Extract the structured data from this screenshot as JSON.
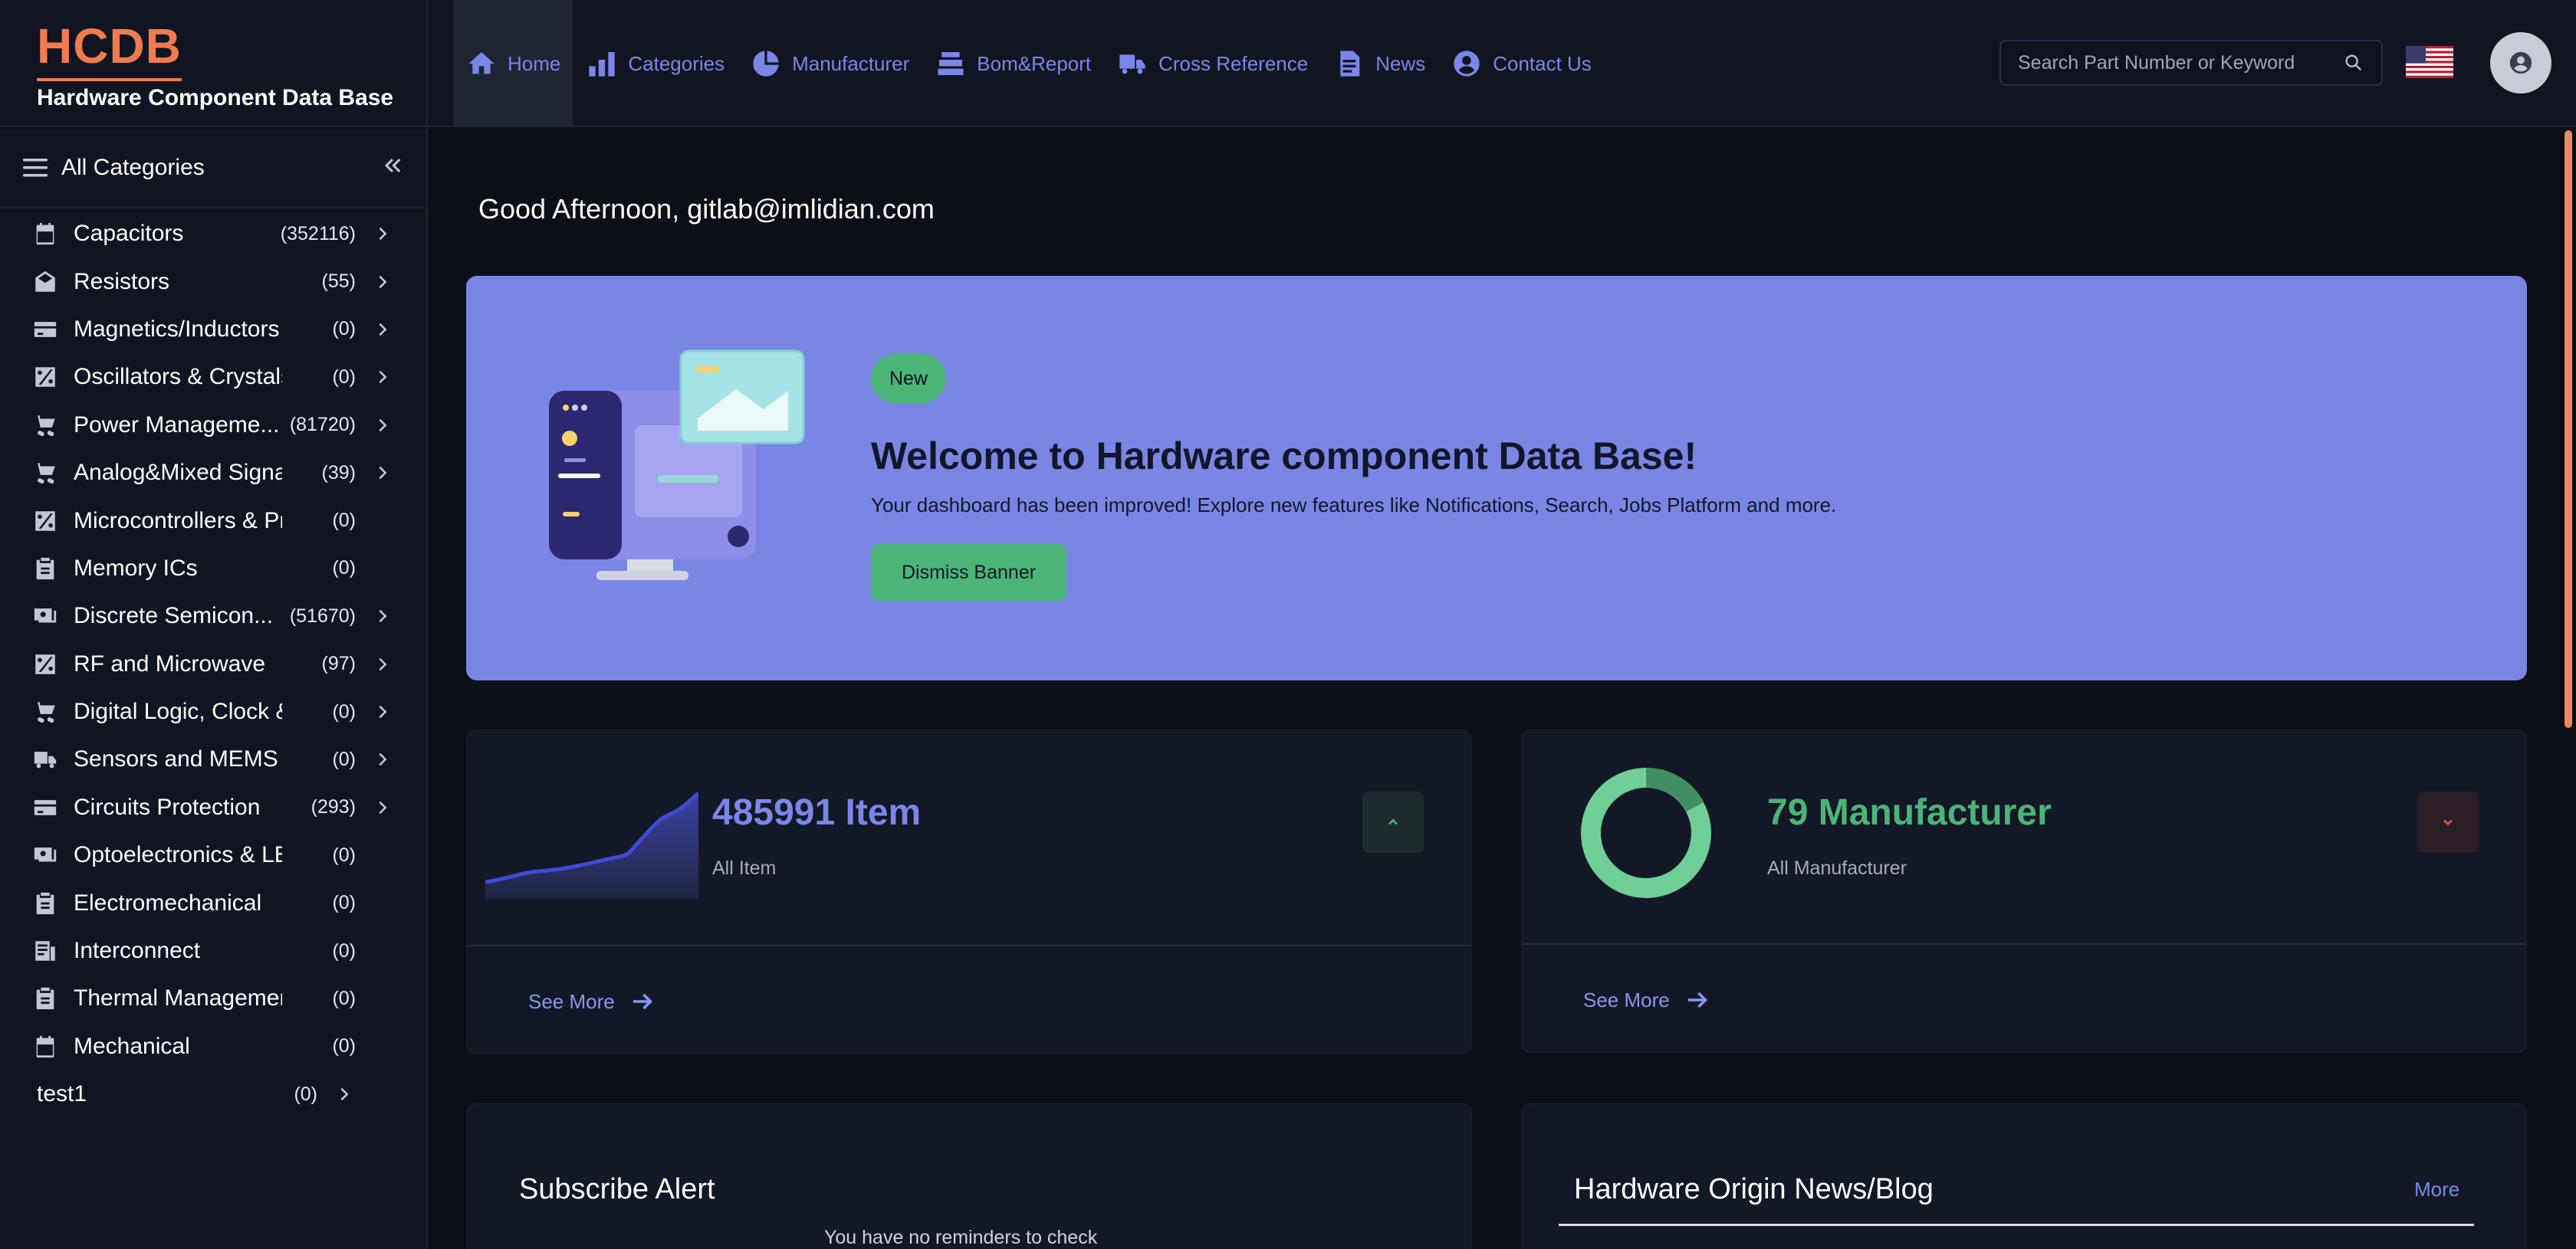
{
  "brand": {
    "logo": "HCDB",
    "subtitle": "Hardware Component Data Base"
  },
  "nav": {
    "items": [
      {
        "label": "Home",
        "icon": "home-icon",
        "active": true
      },
      {
        "label": "Categories",
        "icon": "bar-chart-icon"
      },
      {
        "label": "Manufacturer",
        "icon": "pie-chart-icon"
      },
      {
        "label": "Bom&Report",
        "icon": "stack-icon"
      },
      {
        "label": "Cross Reference",
        "icon": "truck-icon"
      },
      {
        "label": "News",
        "icon": "document-icon"
      },
      {
        "label": "Contact Us",
        "icon": "user-circle-icon"
      }
    ],
    "search_placeholder": "Search Part Number or Keyword",
    "language_flag": "us-flag-icon",
    "avatar_icon": "user-avatar-icon"
  },
  "sidebar": {
    "title": "All Categories",
    "items": [
      {
        "label": "Capacitors",
        "count": "(352116)",
        "icon": "calendar-icon",
        "chevron": true
      },
      {
        "label": "Resistors",
        "count": "(55)",
        "icon": "mail-open-icon",
        "chevron": true
      },
      {
        "label": "Magnetics/Inductors",
        "count": "(0)",
        "icon": "card-icon",
        "chevron": true
      },
      {
        "label": "Oscillators & Crystals",
        "count": "(0)",
        "icon": "percent-icon",
        "chevron": true
      },
      {
        "label": "Power Manageme...",
        "count": "(81720)",
        "icon": "cart-icon",
        "chevron": true
      },
      {
        "label": "Analog&Mixed Signa...",
        "count": "(39)",
        "icon": "cart-icon",
        "chevron": true
      },
      {
        "label": "Microcontrollers & Pr...",
        "count": "(0)",
        "icon": "percent-icon",
        "chevron": false
      },
      {
        "label": "Memory ICs",
        "count": "(0)",
        "icon": "clipboard-icon",
        "chevron": false
      },
      {
        "label": "Discrete Semicon...",
        "count": "(51670)",
        "icon": "cash-icon",
        "chevron": true
      },
      {
        "label": "RF and Microwave",
        "count": "(97)",
        "icon": "percent-icon",
        "chevron": true
      },
      {
        "label": "Digital Logic, Clock & ...",
        "count": "(0)",
        "icon": "cart-icon",
        "chevron": true
      },
      {
        "label": "Sensors and MEMS",
        "count": "(0)",
        "icon": "truck-icon",
        "chevron": true
      },
      {
        "label": "Circuits Protection",
        "count": "(293)",
        "icon": "card-icon",
        "chevron": true
      },
      {
        "label": "Optoelectronics & LEDs",
        "count": "(0)",
        "icon": "cash-icon",
        "chevron": false
      },
      {
        "label": "Electromechanical",
        "count": "(0)",
        "icon": "clipboard-icon",
        "chevron": false
      },
      {
        "label": "Interconnect",
        "count": "(0)",
        "icon": "receipt-icon",
        "chevron": false
      },
      {
        "label": "Thermal Management",
        "count": "(0)",
        "icon": "clipboard-icon",
        "chevron": false
      },
      {
        "label": "Mechanical",
        "count": "(0)",
        "icon": "calendar-icon",
        "chevron": false
      },
      {
        "label": "test1",
        "count": "(0)",
        "icon": "",
        "chevron": true
      }
    ]
  },
  "main": {
    "greeting": "Good Afternoon, gitlab@imlidian.com",
    "banner": {
      "badge": "New",
      "title": "Welcome to Hardware component Data Base!",
      "text": "Your dashboard has been improved! Explore new features like Notifications, Search, Jobs Platform and more.",
      "button": "Dismiss Banner"
    },
    "items_card": {
      "value": "485991 Item",
      "label": "All Item",
      "see_more": "See More",
      "color": "#7b86e8"
    },
    "manufacturer_card": {
      "value": "79 Manufacturer",
      "label": "All Manufacturer",
      "see_more": "See More",
      "color": "#4bb477"
    },
    "subscribe": {
      "title": "Subscribe Alert",
      "note": "You have no reminders to check"
    },
    "news": {
      "title": "Hardware Origin News/Blog",
      "more": "More"
    }
  },
  "colors": {
    "accent": "#7b86e8",
    "brand": "#f07b4f",
    "success": "#4bb477",
    "banner_bg": "#7a86e4"
  }
}
